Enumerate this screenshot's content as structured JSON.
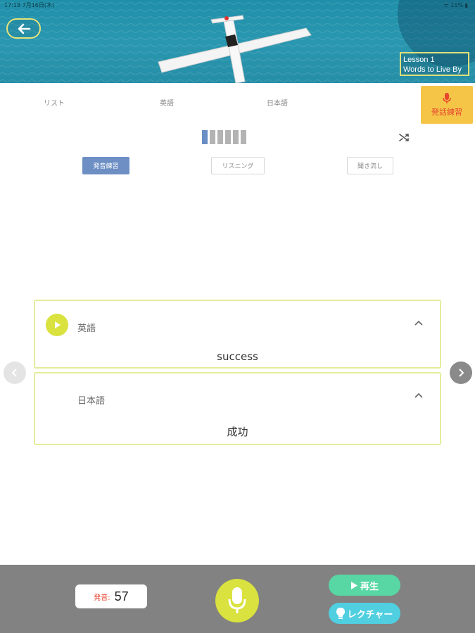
{
  "status_bar": {
    "time": "17:18  7月16日(木)",
    "right": "ᯤ 11%  ▮"
  },
  "header": {
    "lesson_number": "Lesson 1",
    "lesson_title": "Words to Live By"
  },
  "tabs": {
    "list": "リスト",
    "english": "英語",
    "japanese": "日本語",
    "practice": "発話練習"
  },
  "progress": {
    "total": 6,
    "current": 1
  },
  "modes": {
    "pronunciation": "発音練習",
    "listening": "リスニング",
    "flow": "聞き流し"
  },
  "cards": {
    "english": {
      "label": "英語",
      "word": "success"
    },
    "japanese": {
      "label": "日本語",
      "word": "成功"
    }
  },
  "bottom": {
    "score_label": "発音:",
    "score_value": "57",
    "play_label": "再生",
    "lecture_label": "レクチャー"
  },
  "colors": {
    "accent_yellow": "#d9e23e",
    "practice_tab": "#f5c548",
    "mode_active": "#6d8fc4",
    "play_green": "#58d7a4",
    "lecture_cyan": "#4fcfe0",
    "card_border": "#e4ec9b"
  },
  "icons": [
    "back-arrow-icon",
    "airplane-image",
    "mic-icon",
    "shuffle-icon",
    "play-icon",
    "chevron-up-icon",
    "chevron-left-icon",
    "chevron-right-icon",
    "lightbulb-icon"
  ]
}
